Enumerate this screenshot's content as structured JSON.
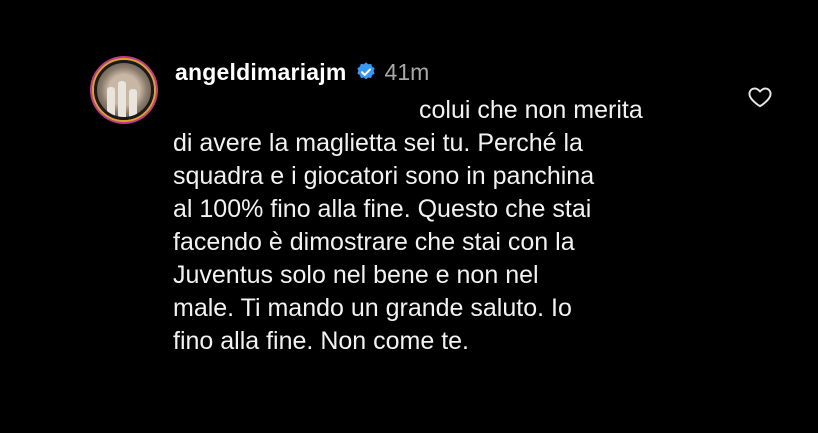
{
  "comment": {
    "username": "angeldimariajm",
    "timestamp": "41m",
    "lines": [
      "colui che non merita",
      "di avere la maglietta sei tu. Perché la",
      "squadra e i giocatori sono in panchina",
      "al 100% fino alla fine. Questo che stai",
      "facendo è dimostrare che stai con la",
      "Juventus solo nel bene e non nel",
      "male. Ti mando un grande saluto. Io",
      "fino alla fine. Non come te."
    ]
  },
  "icons": {
    "verified": "verified-badge-icon",
    "like": "heart-outline-icon"
  },
  "colors": {
    "background": "#000000",
    "text": "#f2f2f2",
    "timestamp": "#a8a8a8",
    "verified": "#3897f0"
  }
}
